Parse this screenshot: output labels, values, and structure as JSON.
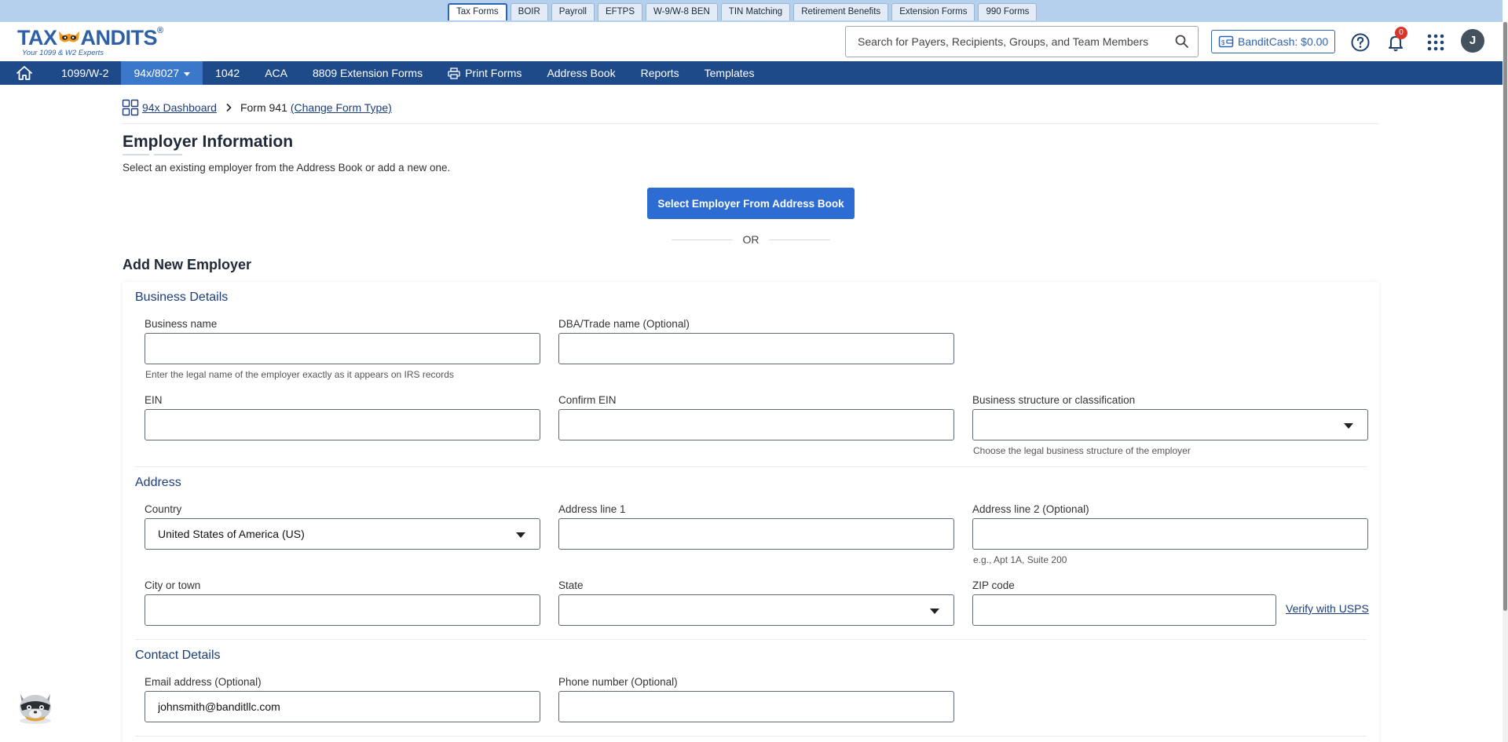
{
  "top_tabs": [
    "Tax Forms",
    "BOIR",
    "Payroll",
    "EFTPS",
    "W-9/W-8 BEN",
    "TIN Matching",
    "Retirement Benefits",
    "Extension Forms",
    "990 Forms"
  ],
  "header": {
    "logo_text": "TAX",
    "logo_text2": "ANDITS",
    "logo_reg": "®",
    "logo_tagline": "Your 1099 & W2 Experts",
    "search_placeholder": "Search for Payers, Recipients, Groups, and Team Members",
    "bandit_cash_label": "BanditCash: $0.00",
    "notification_count": "0",
    "avatar_initial": "J"
  },
  "nav": {
    "items": [
      "1099/W-2",
      "94x/8027",
      "1042",
      "ACA",
      "8809 Extension Forms",
      "Print Forms",
      "Address Book",
      "Reports",
      "Templates"
    ],
    "active": "94x/8027"
  },
  "breadcrumb": {
    "dashboard": "94x Dashboard",
    "form": "Form 941",
    "change": "(Change Form Type)"
  },
  "page": {
    "title": "Employer Information",
    "subtitle": "Select an existing employer from the Address Book or add a new one.",
    "select_button": "Select Employer From Address Book",
    "or_text": "OR",
    "add_new_title": "Add New Employer"
  },
  "form": {
    "business_details": {
      "title": "Business Details",
      "business_name_label": "Business name",
      "business_name_value": "",
      "business_name_hint": "Enter the legal name of the employer exactly as it appears on IRS records",
      "dba_label": "DBA/Trade name (Optional)",
      "dba_value": "",
      "ein_label": "EIN",
      "ein_value": "",
      "confirm_ein_label": "Confirm EIN",
      "confirm_ein_value": "",
      "structure_label": "Business structure or classification",
      "structure_value": "",
      "structure_hint": "Choose the legal business structure of the employer"
    },
    "address": {
      "title": "Address",
      "country_label": "Country",
      "country_value": "United States of America (US)",
      "line1_label": "Address line 1",
      "line1_value": "",
      "line2_label": "Address line 2 (Optional)",
      "line2_value": "",
      "line2_hint": "e.g., Apt 1A, Suite 200",
      "city_label": "City or town",
      "city_value": "",
      "state_label": "State",
      "state_value": "",
      "zip_label": "ZIP code",
      "zip_value": "",
      "verify_link": "Verify with USPS"
    },
    "contact": {
      "title": "Contact Details",
      "email_label": "Email address (Optional)",
      "email_value": "johnsmith@banditllc.com",
      "phone_label": "Phone number (Optional)",
      "phone_value": ""
    }
  },
  "colors": {
    "tabstrip_bg": "#b5d0ec",
    "navbar_bg": "#1e4a8a",
    "navbar_active": "#3b78c9",
    "primary_button": "#2d6dd3",
    "section_title": "#1b3e7a",
    "badge": "#d9362b"
  },
  "icons": {
    "home": "home-icon",
    "print": "printer-icon",
    "search": "search-icon",
    "wallet": "wallet-icon",
    "help": "help-circle-icon",
    "bell": "bell-icon",
    "apps": "apps-grid-icon",
    "dashboard": "dashboard-grid-icon",
    "mascot": "raccoon-mascot-icon"
  }
}
